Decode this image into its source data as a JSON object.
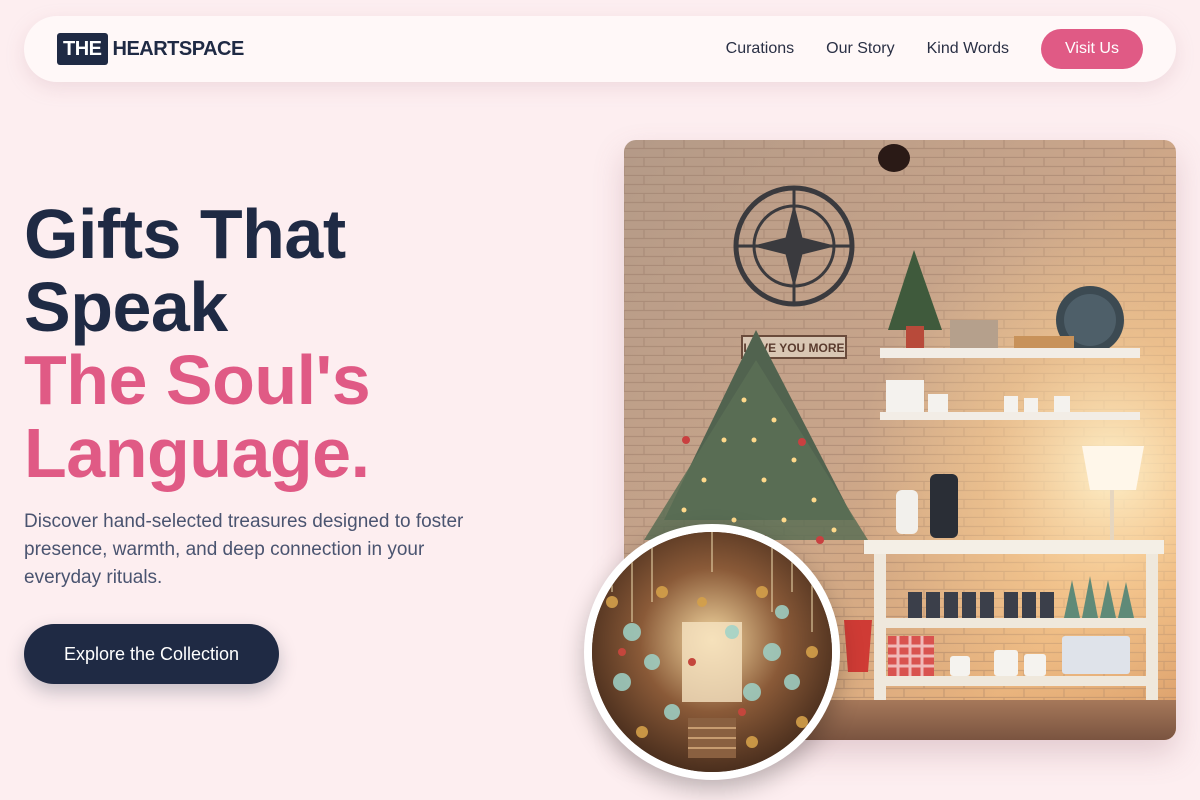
{
  "brand": {
    "logo_mark": "THE",
    "logo_text": "HEARTSPACE"
  },
  "nav": {
    "links": [
      "Curations",
      "Our Story",
      "Kind Words"
    ],
    "cta_label": "Visit Us"
  },
  "hero": {
    "headline_line1": "Gifts That",
    "headline_line2": "Speak",
    "headline_line3": "The Soul's",
    "headline_line4": "Language.",
    "description": "Discover hand-selected treasures designed to foster presence, warmth, and deep connection in your everyday rituals.",
    "cta_label": "Explore the Collection"
  },
  "images": {
    "main_photo": "gift-shop-interior-photo",
    "round_photo": "hanging-ornaments-photo",
    "sign_text": "LOVE YOU MORE"
  },
  "colors": {
    "background": "#fdeef0",
    "navy": "#1f2a44",
    "pink": "#e05a85"
  }
}
